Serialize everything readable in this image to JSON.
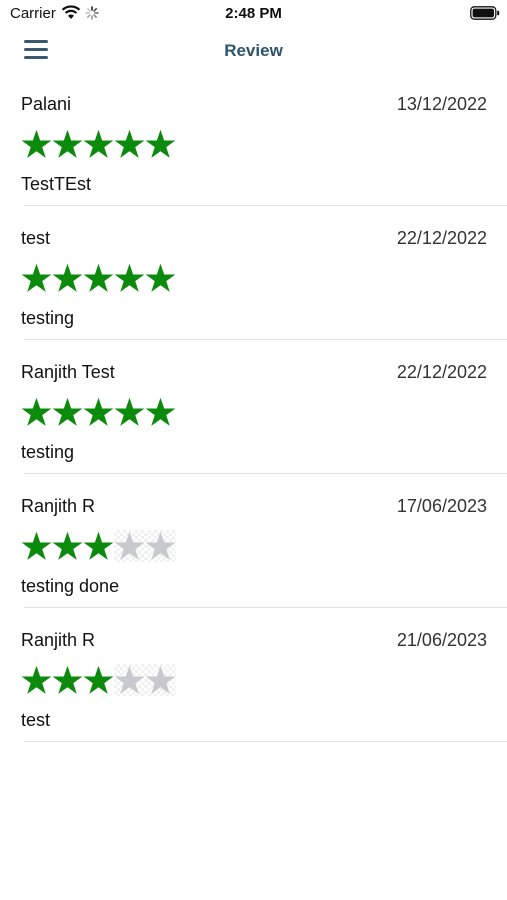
{
  "status_bar": {
    "carrier": "Carrier",
    "time": "2:48 PM",
    "icons": [
      "wifi-icon",
      "activity-spinner-icon",
      "battery-icon"
    ]
  },
  "nav": {
    "title": "Review",
    "menu_icon": "hamburger-menu-icon",
    "accent_color": "#2f536d"
  },
  "star_colors": {
    "filled": "#0b8a0b",
    "empty": "#c8c8cf"
  },
  "reviews": [
    {
      "name": "Palani",
      "date": "13/12/2022",
      "rating": 5,
      "max_rating": 5,
      "comment": "TestTEst"
    },
    {
      "name": "test",
      "date": "22/12/2022",
      "rating": 5,
      "max_rating": 5,
      "comment": "testing"
    },
    {
      "name": "Ranjith Test",
      "date": "22/12/2022",
      "rating": 5,
      "max_rating": 5,
      "comment": "testing"
    },
    {
      "name": "Ranjith R",
      "date": "17/06/2023",
      "rating": 3,
      "max_rating": 5,
      "comment": "testing done"
    },
    {
      "name": "Ranjith R",
      "date": "21/06/2023",
      "rating": 3,
      "max_rating": 5,
      "comment": "test"
    }
  ]
}
